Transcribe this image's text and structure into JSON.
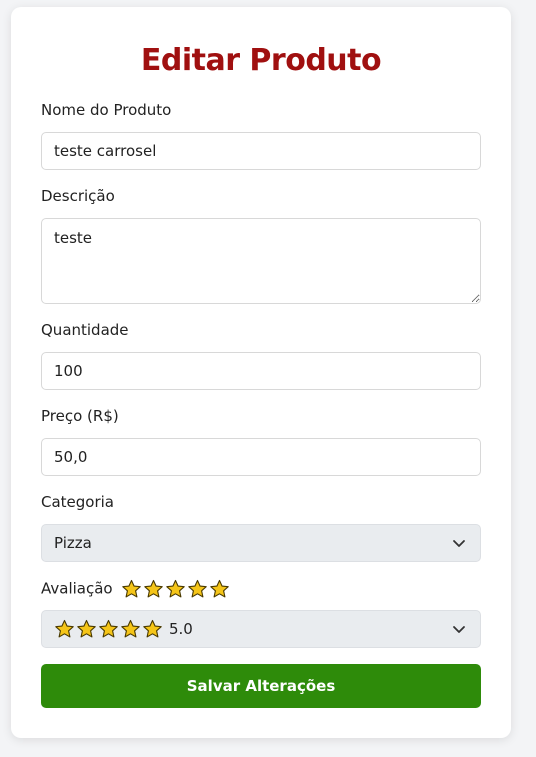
{
  "form": {
    "title": "Editar Produto",
    "name_label": "Nome do Produto",
    "name_value": "teste carrosel",
    "description_label": "Descrição",
    "description_value": "teste",
    "quantity_label": "Quantidade",
    "quantity_value": "100",
    "price_label": "Preço (R$)",
    "price_value": "50,0",
    "category_label": "Categoria",
    "category_selected": "Pizza",
    "rating_label": "Avaliação",
    "rating_value": 5,
    "rating_selected_text": "5.0",
    "save_label": "Salvar Alterações"
  },
  "colors": {
    "title": "#a01010",
    "button": "#2e8b0a",
    "star_fill": "#f5c518",
    "star_stroke": "#4a3a00"
  },
  "icons": {
    "star": "star-icon",
    "dropdown": "chevron-down-icon"
  }
}
